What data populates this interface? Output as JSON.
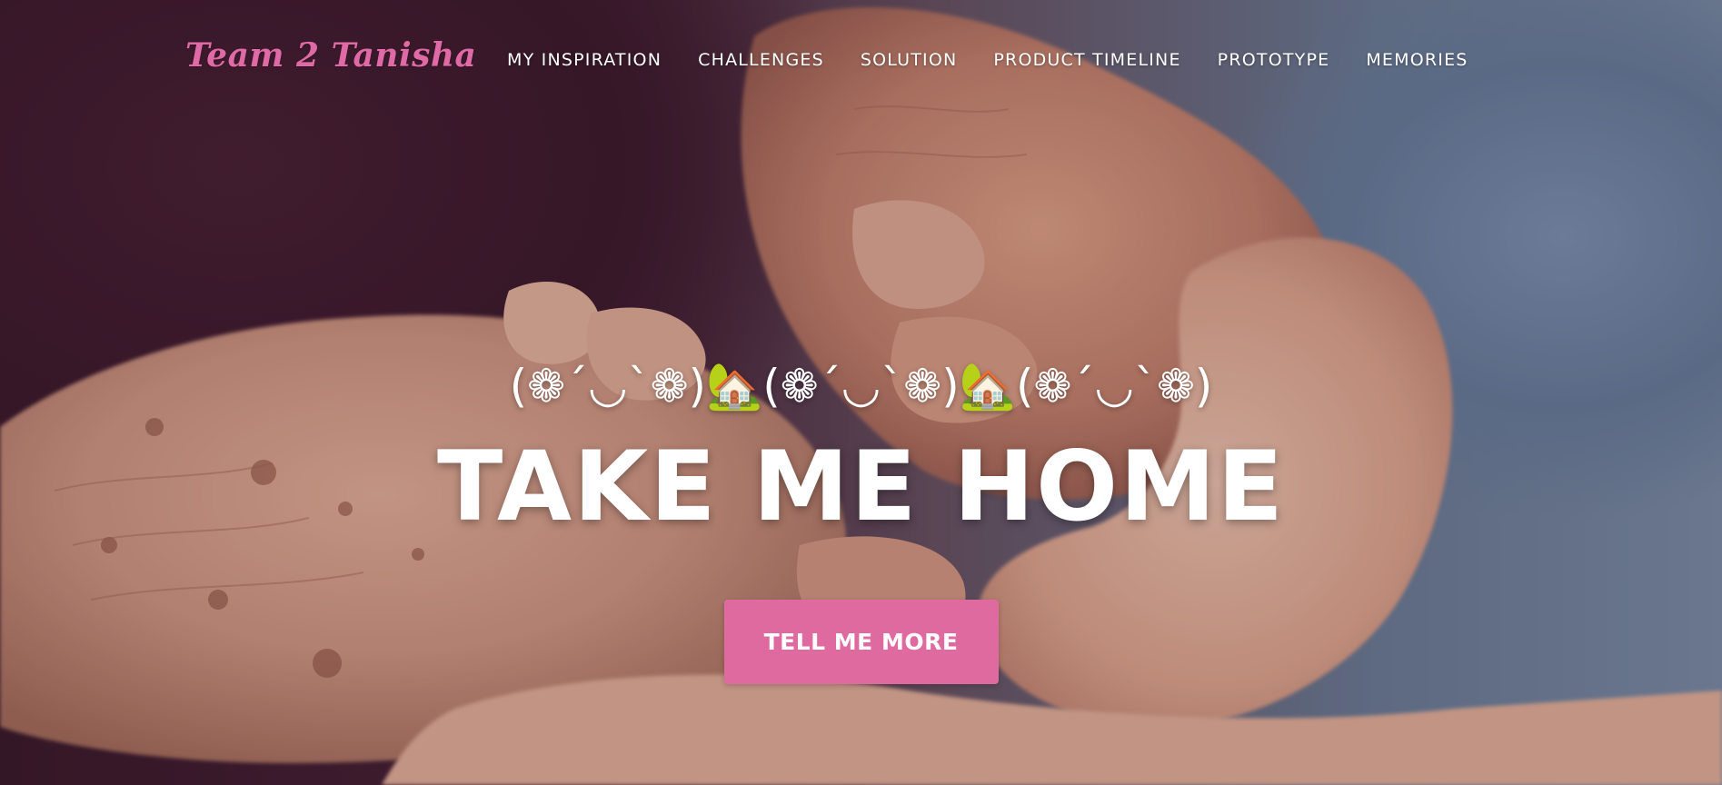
{
  "navbar": {
    "brand": "Team 2 Tanisha",
    "links": [
      {
        "label": "MY INSPIRATION"
      },
      {
        "label": "CHALLENGES"
      },
      {
        "label": "SOLUTION"
      },
      {
        "label": "PRODUCT TIMELINE"
      },
      {
        "label": "PROTOTYPE"
      },
      {
        "label": "MEMORIES"
      }
    ]
  },
  "hero": {
    "subheading": "(❁´◡`❁)🏡(❁´◡`❁)🏡(❁´◡`❁)",
    "heading": "TAKE ME HOME",
    "button_label": "TELL ME MORE",
    "background_description_icon": "holding-hands-photo"
  },
  "colors": {
    "accent": "#de6aa0",
    "brand": "#e06aa6",
    "nav_text": "#ffffff"
  }
}
